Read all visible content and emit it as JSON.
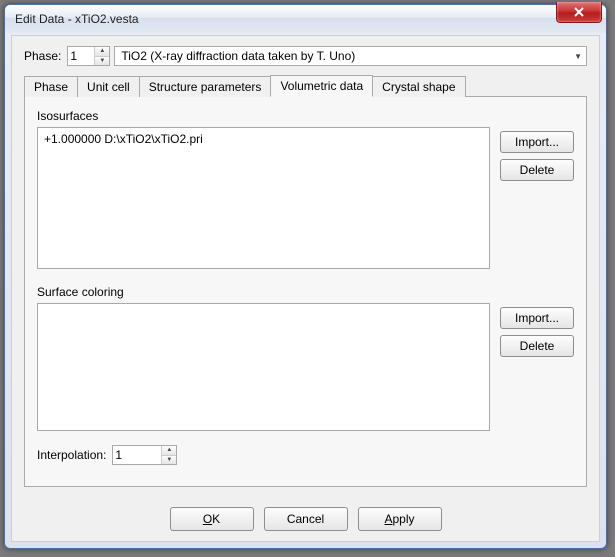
{
  "window": {
    "title": "Edit Data - xTiO2.vesta"
  },
  "phase": {
    "label": "Phase:",
    "value": "1",
    "dropdown_selected": "TiO2 (X-ray diffraction data taken by T. Uno)"
  },
  "tabs": {
    "items": [
      {
        "label": "Phase"
      },
      {
        "label": "Unit cell"
      },
      {
        "label": "Structure parameters"
      },
      {
        "label": "Volumetric data"
      },
      {
        "label": "Crystal shape"
      }
    ],
    "active_index": 3
  },
  "volumetric": {
    "isosurfaces_label": "Isosurfaces",
    "isosurfaces_items": [
      "+1.000000 D:\\xTiO2\\xTiO2.pri"
    ],
    "surface_coloring_label": "Surface coloring",
    "surface_coloring_items": [],
    "import_label": "Import...",
    "delete_label": "Delete",
    "interp_label": "Interpolation:",
    "interp_value": "1"
  },
  "footer": {
    "ok": "OK",
    "cancel": "Cancel",
    "apply": "Apply"
  }
}
